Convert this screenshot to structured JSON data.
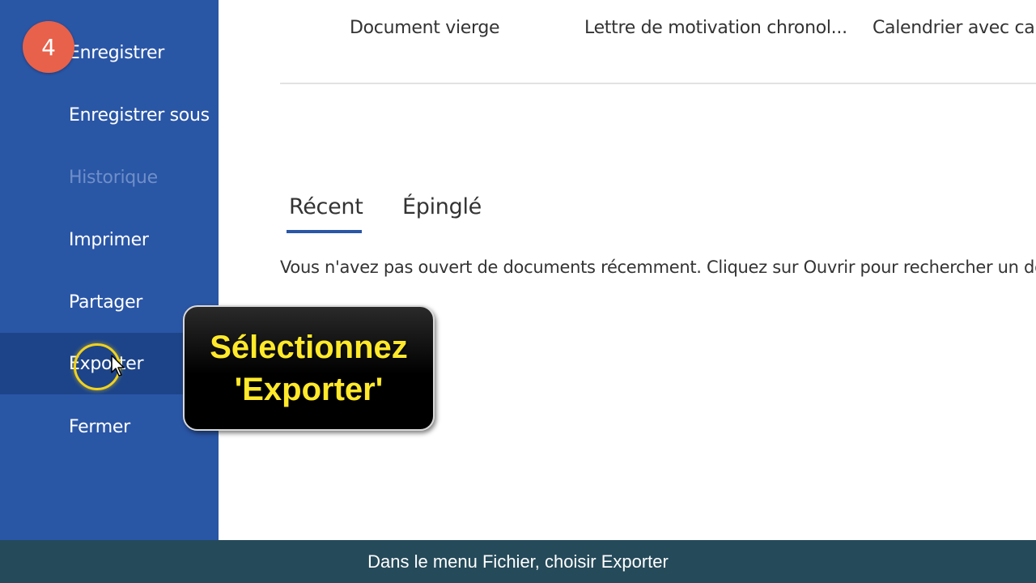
{
  "sidebar": {
    "items": [
      {
        "label": "Enregistrer",
        "state": "normal"
      },
      {
        "label": "Enregistrer sous",
        "state": "normal"
      },
      {
        "label": "Historique",
        "state": "disabled"
      },
      {
        "label": "Imprimer",
        "state": "normal"
      },
      {
        "label": "Partager",
        "state": "normal"
      },
      {
        "label": "Exporter",
        "state": "selected"
      },
      {
        "label": "Fermer",
        "state": "normal"
      }
    ],
    "background_color": "#2a56a6",
    "selected_color": "#1d4489"
  },
  "step_badge": {
    "number": "4",
    "color": "#e8614a"
  },
  "templates": [
    {
      "title": "Document vierge"
    },
    {
      "title": "Lettre de motivation chronol..."
    },
    {
      "title": "Calendrier avec capt"
    }
  ],
  "tabs": [
    {
      "label": "Récent",
      "active": true
    },
    {
      "label": "Épinglé",
      "active": false
    }
  ],
  "empty_message": "Vous n'avez pas ouvert de documents récemment. Cliquez sur Ouvrir pour rechercher un doc",
  "callout": {
    "line1": "Sélectionnez",
    "line2": "'Exporter'",
    "text_color": "#ffe92a"
  },
  "caption": {
    "text": "Dans le menu Fichier, choisir Exporter",
    "background_color": "#254a5a"
  },
  "icons": {
    "cursor": "mouse-pointer-icon",
    "highlight": "click-highlight-ring"
  }
}
